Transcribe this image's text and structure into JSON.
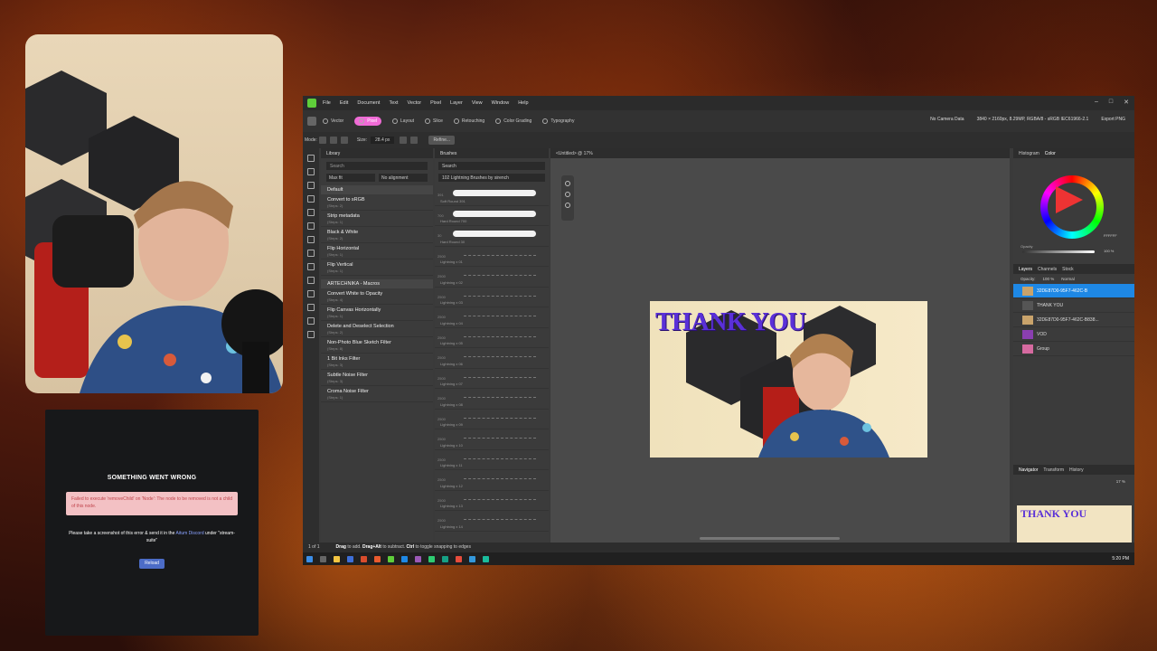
{
  "error_panel": {
    "title": "SOMETHING WENT WRONG",
    "error_text": "Failed to execute 'removeChild' on 'Node': The node to be removed is not a child of this node.",
    "message_prefix": "Please take a screenshot of this error & send it in the",
    "message_link": "Aitum Discord",
    "message_suffix": "under \"stream-suite\"",
    "reload_label": "Reload"
  },
  "app": {
    "menu": [
      "File",
      "Edit",
      "Document",
      "Text",
      "Vector",
      "Pixel",
      "Layer",
      "View",
      "Window",
      "Help"
    ],
    "personas": [
      {
        "label": "Vector",
        "active": false
      },
      {
        "label": "Pixel",
        "active": true
      },
      {
        "label": "Layout",
        "active": false
      },
      {
        "label": "Slice",
        "active": false
      },
      {
        "label": "Retouching",
        "active": false
      },
      {
        "label": "Color Grading",
        "active": false
      },
      {
        "label": "Typography",
        "active": false
      }
    ],
    "camera_data": "No Camera Data",
    "doc_info": "3840 × 2160px, 8.29MP, RGBA/8 - sRGB IEC61966-2.1",
    "export_label": "Export PNG",
    "context": {
      "mode_label": "Mode:",
      "size_label": "Size:",
      "size_value": "28.4 px",
      "refine_label": "Refine..."
    },
    "library": {
      "tab": "Library",
      "search_placeholder": "Search",
      "fit": "Max fit",
      "alignment": "No alignment",
      "groups": [
        {
          "name": "Default",
          "items": [
            {
              "name": "Convert to sRGB",
              "steps": "(Steps: 2)"
            },
            {
              "name": "Strip metadata",
              "steps": "(Steps: 1)"
            },
            {
              "name": "Black & White",
              "steps": "(Steps: 2)"
            },
            {
              "name": "Flip Horizontal",
              "steps": "(Steps: 1)"
            },
            {
              "name": "Flip Vertical",
              "steps": "(Steps: 1)"
            }
          ]
        },
        {
          "name": "ARTECHNIKA - Macros",
          "items": [
            {
              "name": "Convert White to Opacity",
              "steps": "(Steps: 4)"
            },
            {
              "name": "Flip Canvas Horizontally",
              "steps": "(Steps: 1)"
            },
            {
              "name": "Delete and Deselect Selection",
              "steps": "(Steps: 2)"
            },
            {
              "name": "Non-Photo Blue Sketch Filter",
              "steps": "(Steps: 8)"
            },
            {
              "name": "1 Bit Inks Filter",
              "steps": "(Steps: 3)"
            },
            {
              "name": "Subtle Noise Filter",
              "steps": "(Steps: 3)"
            },
            {
              "name": "Croma Noise Filter",
              "steps": "(Steps: 1)"
            }
          ]
        }
      ]
    },
    "brushes": {
      "tab": "Brushes",
      "search_placeholder": "Search",
      "category": "102 Lightning Brushes by sirench",
      "items": [
        {
          "size": "391",
          "name": "Soft Round 391",
          "kind": "stroke"
        },
        {
          "size": "700",
          "name": "Hard Round 700",
          "kind": "stroke"
        },
        {
          "size": "30",
          "name": "Hard Round 30",
          "kind": "stroke"
        },
        {
          "size": "2500",
          "name": "Lightning x 01",
          "kind": "thin"
        },
        {
          "size": "2500",
          "name": "Lightning x 02",
          "kind": "thin"
        },
        {
          "size": "2500",
          "name": "Lightning x 03",
          "kind": "thin"
        },
        {
          "size": "2500",
          "name": "Lightning x 04",
          "kind": "thin"
        },
        {
          "size": "2500",
          "name": "Lightning x 05",
          "kind": "thin"
        },
        {
          "size": "2500",
          "name": "Lightning x 06",
          "kind": "thin"
        },
        {
          "size": "2500",
          "name": "Lightning x 07",
          "kind": "thin"
        },
        {
          "size": "2500",
          "name": "Lightning x 08",
          "kind": "thin"
        },
        {
          "size": "2500",
          "name": "Lightning x 09",
          "kind": "thin"
        },
        {
          "size": "2500",
          "name": "Lightning x 10",
          "kind": "thin"
        },
        {
          "size": "2500",
          "name": "Lightning x 11",
          "kind": "thin"
        },
        {
          "size": "2500",
          "name": "Lightning x 12",
          "kind": "thin"
        },
        {
          "size": "2500",
          "name": "Lightning x 13",
          "kind": "thin"
        },
        {
          "size": "2500",
          "name": "Lightning x 14",
          "kind": "thin"
        }
      ]
    },
    "document": {
      "tab_title": "<Untitled> @ 17%",
      "artwork_title": "THANK YOU"
    },
    "color": {
      "tabs": [
        "Histogram",
        "Color"
      ],
      "hex": "FFFFFF",
      "opacity_label": "Opacity",
      "opacity_value": "100 %"
    },
    "layers": {
      "tabs": [
        "Layers",
        "Channels",
        "Stock"
      ],
      "opacity_label": "Opacity:",
      "opacity_value": "100 %",
      "blend": "Normal",
      "items": [
        {
          "name": "32DE87D0-95F7-462C-B",
          "selected": true
        },
        {
          "name": "THANK YOU",
          "selected": false
        },
        {
          "name": "32DE87D0-95F7-462C-B838...",
          "selected": false
        },
        {
          "name": "VOD",
          "selected": false
        },
        {
          "name": "Group",
          "selected": false
        }
      ]
    },
    "navigator": {
      "tabs": [
        "Navigator",
        "Transform",
        "History"
      ],
      "zoom": "17 %",
      "thumb_title": "THANK YOU"
    },
    "status": {
      "page": "1 of 1",
      "hint_bold1": "Drag",
      "hint1": "to add.",
      "hint_bold2": "Drag+Alt",
      "hint2": "to subtract.",
      "hint_bold3": "Ctrl",
      "hint3": "to toggle snapping to edges"
    },
    "clock": "5:20 PM",
    "colors": {
      "accent_pink": "#f06bd6",
      "selection_blue": "#1e88e5",
      "title_purple": "#5a30d8",
      "logo_green": "#5fce3a"
    }
  }
}
